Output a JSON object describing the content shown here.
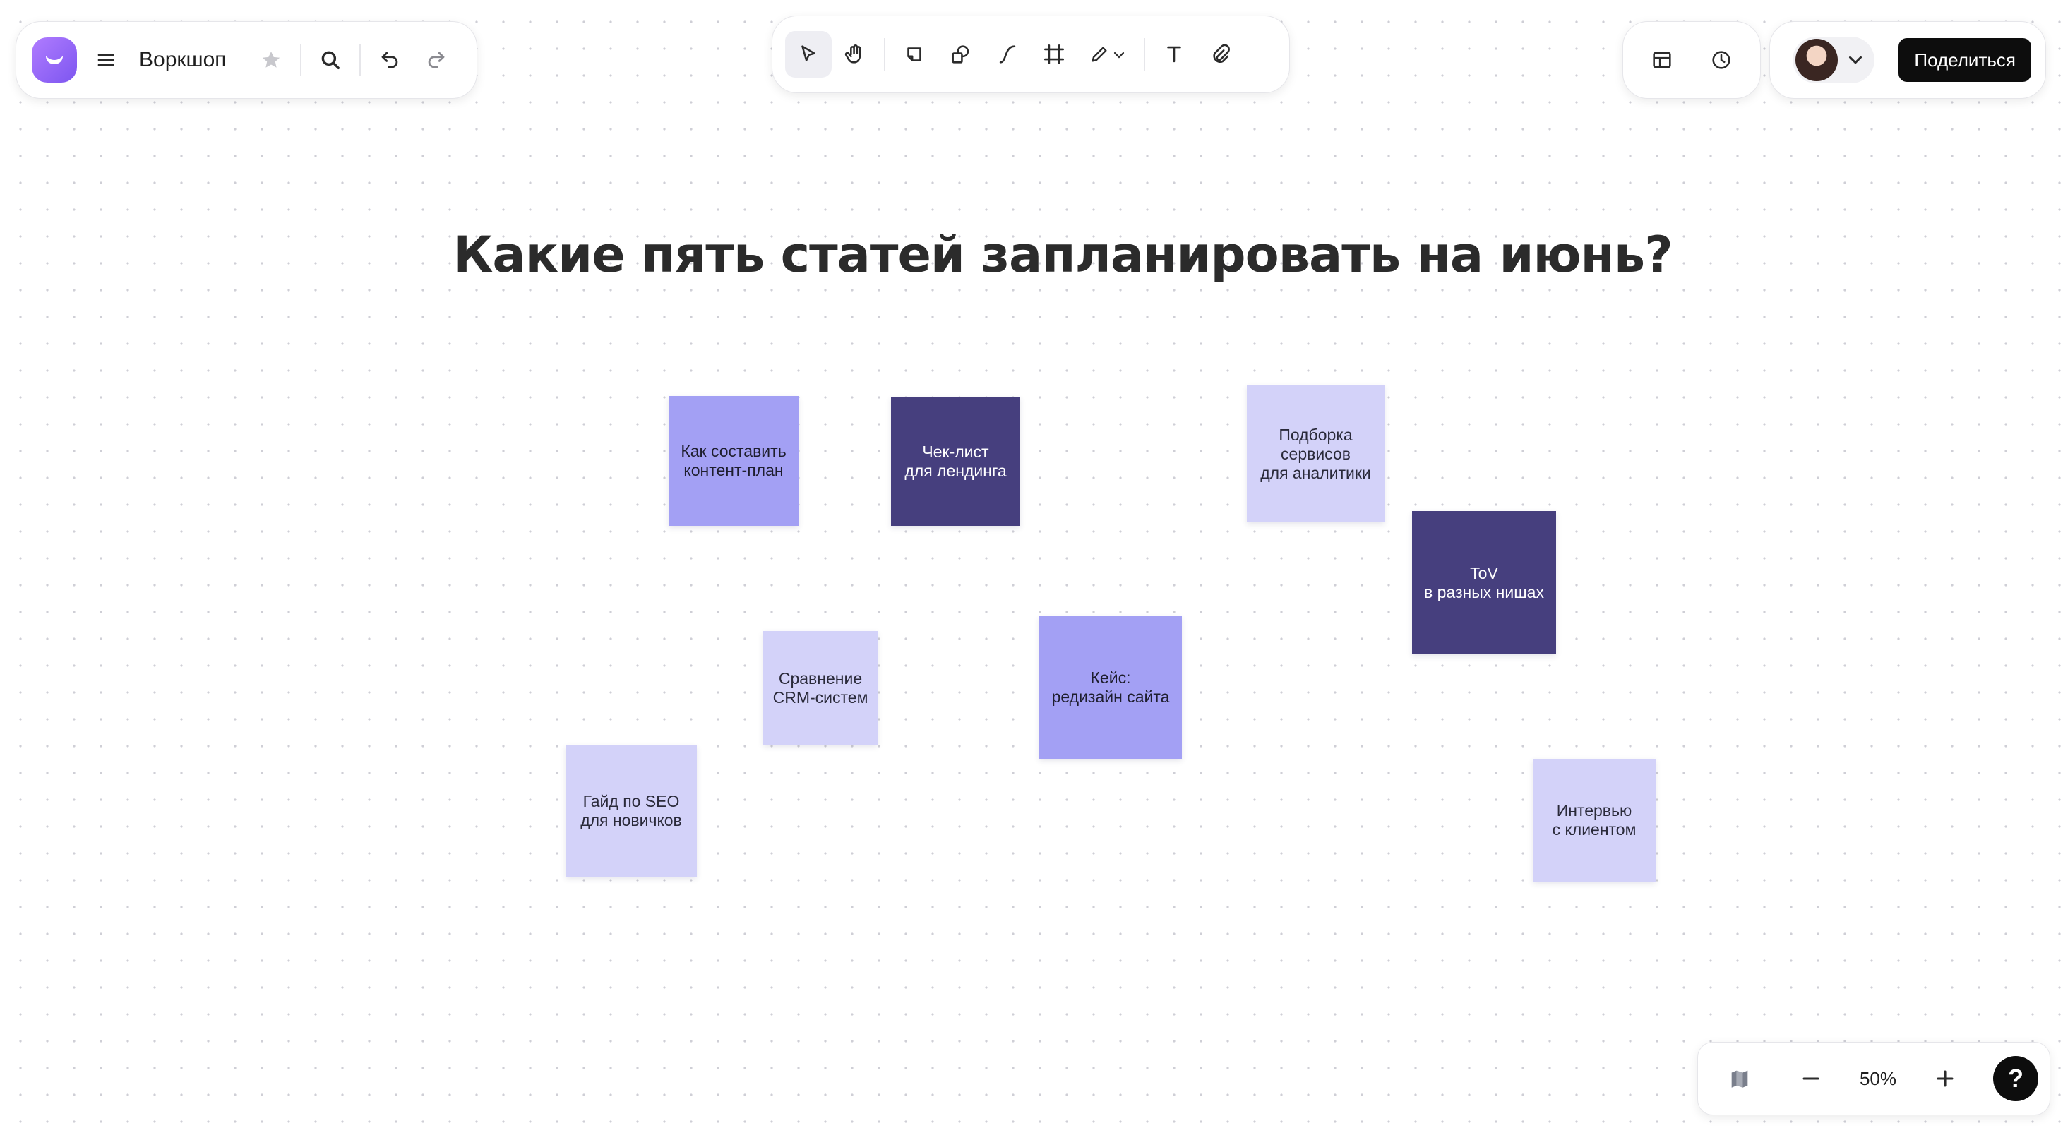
{
  "app": {
    "board_title": "Воркшоп"
  },
  "header": {
    "share_label": "Поделиться"
  },
  "canvas": {
    "heading": "Какие пять статей запланировать на июнь?",
    "stickies": [
      {
        "text": "Как составить\nконтент-план",
        "color": "#a3a0f4"
      },
      {
        "text": "Чек-лист\nдля лендинга",
        "color": "#463f7e"
      },
      {
        "text": "Подборка\nсервисов\nдля аналитики",
        "color": "#d3d2f9"
      },
      {
        "text": "ToV\nв разных нишах",
        "color": "#463f7e"
      },
      {
        "text": "Сравнение\nCRM-систем",
        "color": "#d3d2f9"
      },
      {
        "text": "Кейс:\nредизайн сайта",
        "color": "#a3a0f4"
      },
      {
        "text": "Гайд по SEO\nдля новичков",
        "color": "#d3d2f9"
      },
      {
        "text": "Интервью\nс клиентом",
        "color": "#d3d2f9"
      }
    ]
  },
  "zoom": {
    "level": "50%",
    "help_label": "?"
  },
  "icons": {
    "left": [
      "logo-icon",
      "menu-icon",
      "star-icon",
      "search-icon",
      "undo-icon",
      "redo-icon"
    ],
    "tools": [
      "select-icon",
      "hand-icon",
      "sticky-note-icon",
      "shapes-icon",
      "connector-icon",
      "frame-icon",
      "pen-icon",
      "text-icon",
      "attachment-icon"
    ],
    "right": [
      "layout-icon",
      "history-icon",
      "chevron-down-icon",
      "map-icon",
      "minus-icon",
      "plus-icon",
      "help-icon"
    ]
  },
  "colors": {
    "accent": "#8b5cf6",
    "sticky_mid": "#a3a0f4",
    "sticky_dark": "#463f7e",
    "sticky_light": "#d3d2f9"
  }
}
